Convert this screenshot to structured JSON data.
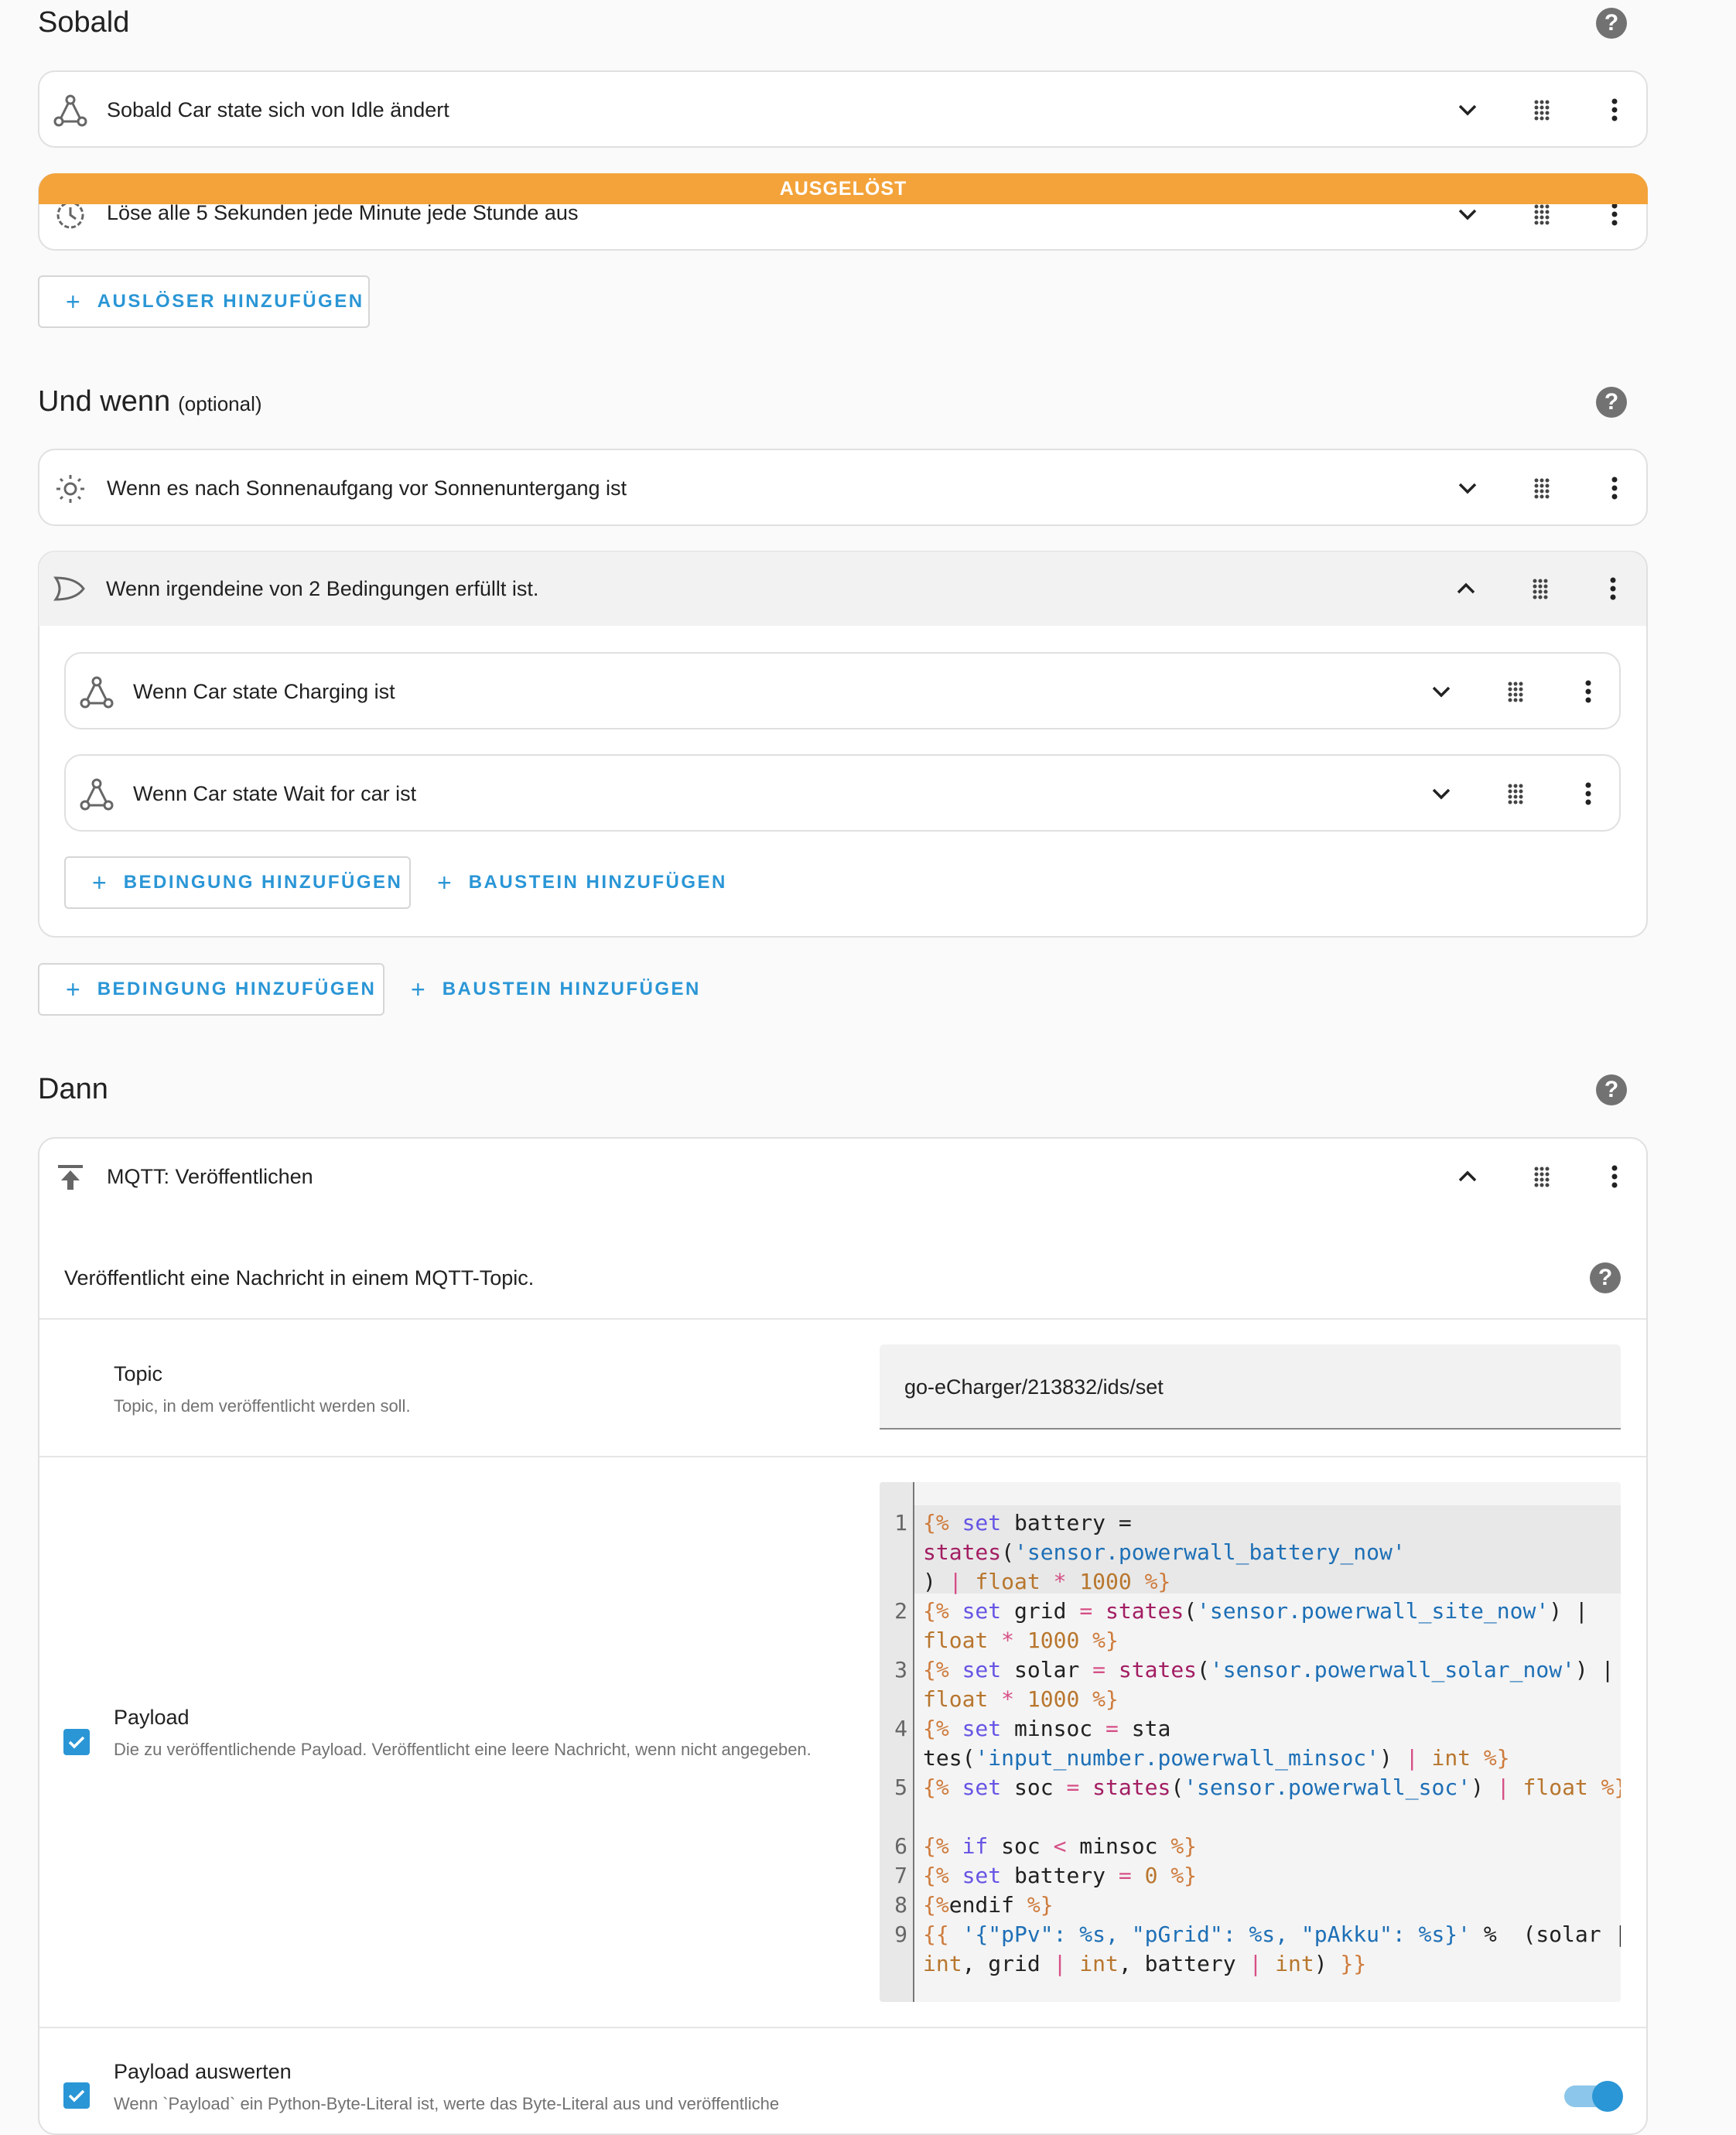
{
  "sections": {
    "triggers_title": "Sobald",
    "conditions_title": "Und wenn",
    "conditions_optional": "(optional)",
    "actions_title": "Dann"
  },
  "triggers": [
    {
      "label": "Sobald Car state sich von Idle ändert",
      "icon": "state-graph-icon"
    },
    {
      "label": "Löse alle 5 Sekunden jede Minute jede Stunde aus",
      "icon": "clock-icon",
      "badge": "AUSGELÖST"
    }
  ],
  "add_trigger_label": "AUSLÖSER HINZUFÜGEN",
  "conditions": [
    {
      "label": "Wenn es nach Sonnenaufgang vor Sonnenuntergang ist",
      "icon": "sun-icon"
    },
    {
      "label": "Wenn irgendeine von 2 Bedingungen erfüllt ist.",
      "icon": "or-gate-icon",
      "children": [
        {
          "label": "Wenn Car state Charging ist",
          "icon": "state-graph-icon"
        },
        {
          "label": "Wenn Car state Wait for car ist",
          "icon": "state-graph-icon"
        }
      ]
    }
  ],
  "add_condition_label": "BEDINGUNG HINZUFÜGEN",
  "add_block_label": "BAUSTEIN HINZUFÜGEN",
  "action": {
    "title": "MQTT: Veröffentlichen",
    "icon": "publish-icon",
    "description": "Veröffentlicht eine Nachricht in einem MQTT-Topic.",
    "topic": {
      "label": "Topic",
      "description": "Topic, in dem veröffentlicht werden soll.",
      "value": "go-eCharger/213832/ids/set"
    },
    "payload": {
      "label": "Payload",
      "description": "Die zu veröffentlichende Payload. Veröffentlicht eine leere Nachricht, wenn nicht angegeben.",
      "checked": true,
      "code_lines": [
        "{% set battery = states('sensor.powerwall_battery_now') | float * 1000 %}",
        "{% set grid = states('sensor.powerwall_site_now') | float * 1000 %}",
        "{% set solar = states('sensor.powerwall_solar_now') | float * 1000 %}",
        "{% set minsoc = states('input_number.powerwall_minsoc') | int %}",
        "{% set soc = states('sensor.powerwall_soc') | float %}",
        "{% if soc < minsoc %}",
        "{% set battery = 0 %}",
        "{%endif %}",
        "{{ '{\"pPv\": %s, \"pGrid\": %s, \"pAkku\": %s}' %  (solar | int, grid | int, battery | int) }}"
      ]
    },
    "evaluate_payload": {
      "label": "Payload auswerten",
      "description": "Wenn `Payload` ein Python-Byte-Literal ist, werte das Byte-Literal aus und veröffentliche",
      "checked": true,
      "toggle_on": true
    }
  },
  "colors": {
    "accent": "#2a96d6",
    "triggered": "#f3a33a"
  }
}
